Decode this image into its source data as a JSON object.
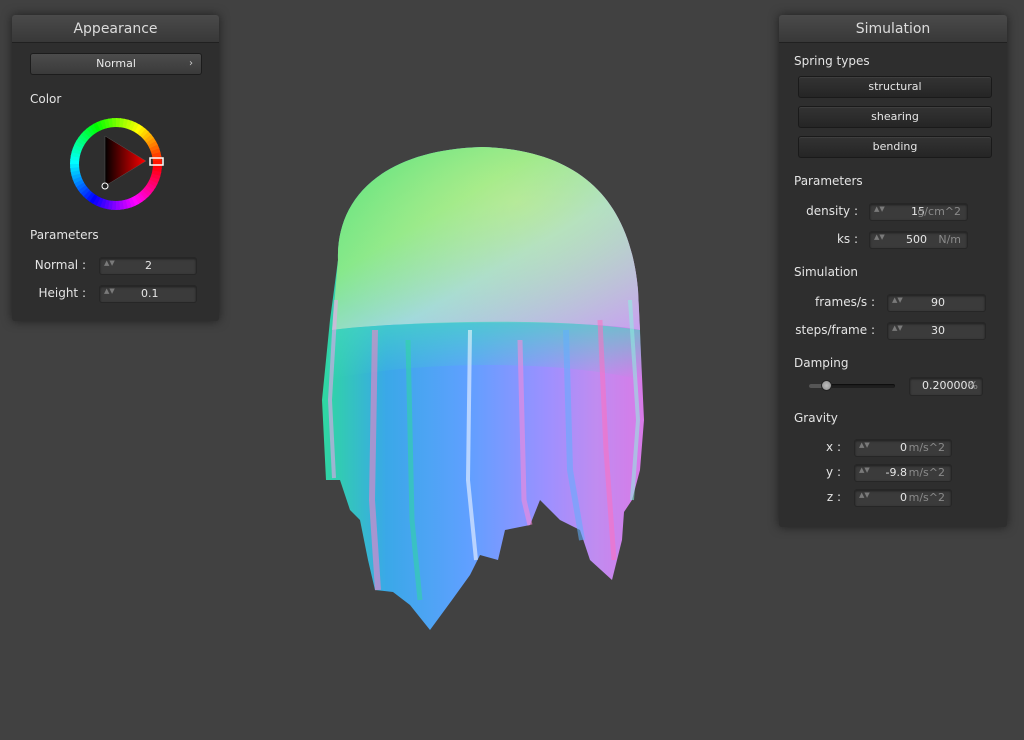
{
  "appearance": {
    "title": "Appearance",
    "shader_combo": {
      "value": "Normal",
      "chevron": "›"
    },
    "color_label": "Color",
    "parameters_label": "Parameters",
    "normal": {
      "label": "Normal :",
      "value": "2"
    },
    "height": {
      "label": "Height :",
      "value": "0.1"
    },
    "spin_glyph": "▲▼"
  },
  "simulation": {
    "title": "Simulation",
    "spring_types_label": "Spring types",
    "spring_buttons": [
      "structural",
      "shearing",
      "bending"
    ],
    "parameters_label": "Parameters",
    "density": {
      "label": "density :",
      "value": "15",
      "unit": "g/cm^2"
    },
    "ks": {
      "label": "ks :",
      "value": "500",
      "unit": "N/m"
    },
    "simulation_label": "Simulation",
    "frames": {
      "label": "frames/s :",
      "value": "90"
    },
    "steps": {
      "label": "steps/frame :",
      "value": "30"
    },
    "damping_label": "Damping",
    "damping": {
      "value": "0.200000",
      "unit": "%",
      "slider_fraction": 0.2
    },
    "gravity_label": "Gravity",
    "gx": {
      "label": "x :",
      "value": "0",
      "unit": "m/s^2"
    },
    "gy": {
      "label": "y :",
      "value": "-9.8",
      "unit": "m/s^2"
    },
    "gz": {
      "label": "z :",
      "value": "0",
      "unit": "m/s^2"
    }
  },
  "viewport": {
    "object": "cloth-draped-on-sphere",
    "shading": "normal-map-colors"
  }
}
